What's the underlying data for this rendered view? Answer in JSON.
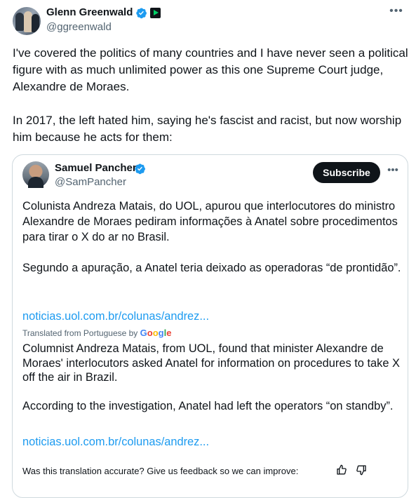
{
  "author": {
    "name": "Glenn Greenwald",
    "handle": "@ggreenwald",
    "avatar_icon": "group-photo-avatar",
    "verified_icon": "verified-badge-icon",
    "affiliate_icon": "rumble-affiliate-icon"
  },
  "tweet": {
    "paragraphs": [
      "I've covered the politics of many countries and I have never seen a political figure with as much unlimited power as this one Supreme Court judge, Alexandre de Moraes.",
      "In 2017, the left hated him, saying he's fascist and racist, but now worship him because he acts for them:"
    ],
    "more_icon": "more-options-icon"
  },
  "quote": {
    "name": "Samuel Pancher",
    "handle": "@SamPancher",
    "subscribe_label": "Subscribe",
    "original_paragraphs": [
      "Colunista Andreza Matais, do UOL, apurou que interlocutores do ministro Alexandre de Moraes pediram informações à Anatel sobre procedimentos para tirar o X do ar no Brasil.",
      "Segundo a apuração, a Anatel teria deixado as operadoras “de prontidão”."
    ],
    "link_1": "noticias.uol.com.br/colunas/andrez...",
    "translated_from": "Translated from Portuguese by ",
    "google_letters": [
      "G",
      "o",
      "o",
      "g",
      "l",
      "e"
    ],
    "translated_paragraphs": [
      "Columnist Andreza Matais, from UOL, found that minister Alexandre de Moraes' interlocutors asked Anatel for information on procedures to take X off the air in Brazil.",
      "According to the investigation, Anatel had left the operators “on standby”."
    ],
    "link_2": "noticias.uol.com.br/colunas/andrez...",
    "feedback_prompt": "Was this translation accurate? Give us feedback so we can improve:"
  },
  "colors": {
    "link": "#1d9bf0",
    "verified": "#1d9bf0",
    "text": "#0f1419",
    "secondary": "#536471",
    "border": "#cfd9de"
  }
}
